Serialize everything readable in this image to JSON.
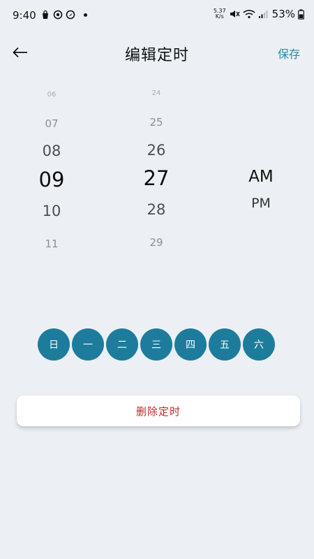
{
  "status_bar": {
    "time": "9:40",
    "net_speed_value": "5.37",
    "net_speed_unit": "K/s",
    "battery": "53%"
  },
  "header": {
    "title": "编辑定时",
    "save_label": "保存"
  },
  "hour_picker": [
    "06",
    "07",
    "08",
    "09",
    "10",
    "11"
  ],
  "minute_picker": [
    "24",
    "25",
    "26",
    "27",
    "28",
    "29"
  ],
  "ampm": {
    "am": "AM",
    "pm": "PM",
    "selected": "AM"
  },
  "weekdays": [
    "日",
    "一",
    "二",
    "三",
    "四",
    "五",
    "六"
  ],
  "delete_label": "删除定时",
  "colors": {
    "accent": "#1d7c9b",
    "save_text": "#2a8aa6",
    "delete_text": "#c62828",
    "background": "#ecf0f4"
  }
}
